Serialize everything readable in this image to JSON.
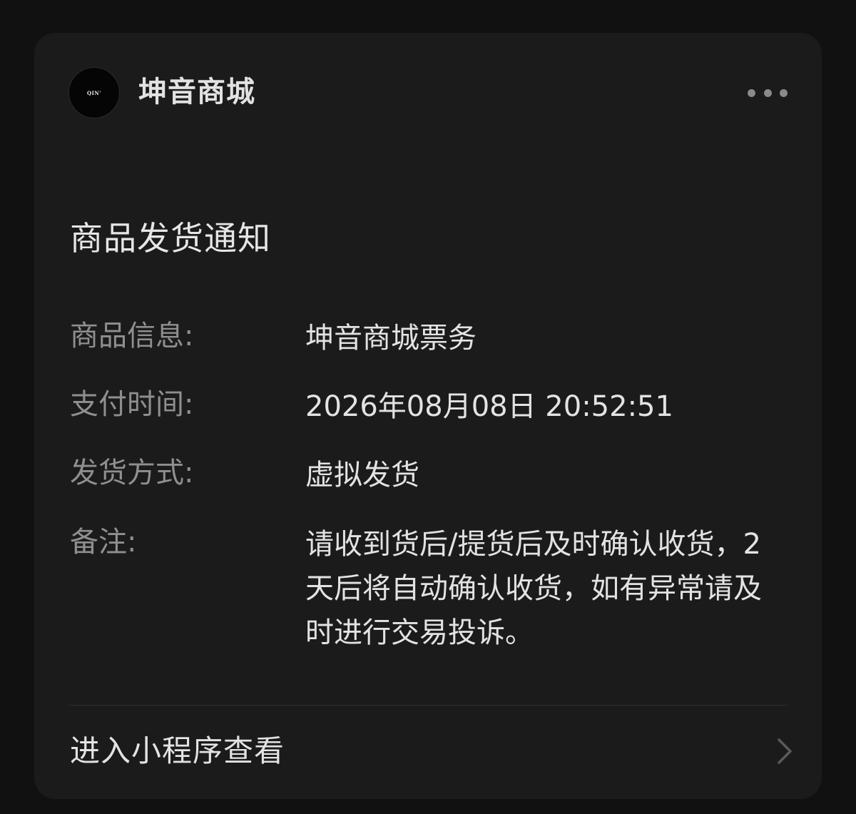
{
  "account": {
    "avatar_text": "QIN'",
    "name": "坤音商城"
  },
  "more": {
    "icon": "more-dots-icon"
  },
  "notice": {
    "title": "商品发货通知",
    "rows": [
      {
        "label": "商品信息:",
        "value": "坤音商城票务"
      },
      {
        "label": "支付时间:",
        "value": "2026年08月08日 20:52:51"
      },
      {
        "label": "发货方式:",
        "value": "虚拟发货"
      },
      {
        "label": "备注:",
        "value": "请收到货后/提货后及时确认收货，2天后将自动确认收货，如有异常请及时进行交易投诉。"
      }
    ]
  },
  "footer": {
    "link_label": "进入小程序查看",
    "icon": "chevron-right-icon"
  },
  "colors": {
    "background": "#111111",
    "card": "#1b1b1b",
    "label": "#8f8f8f",
    "value": "#e3e3e3"
  }
}
